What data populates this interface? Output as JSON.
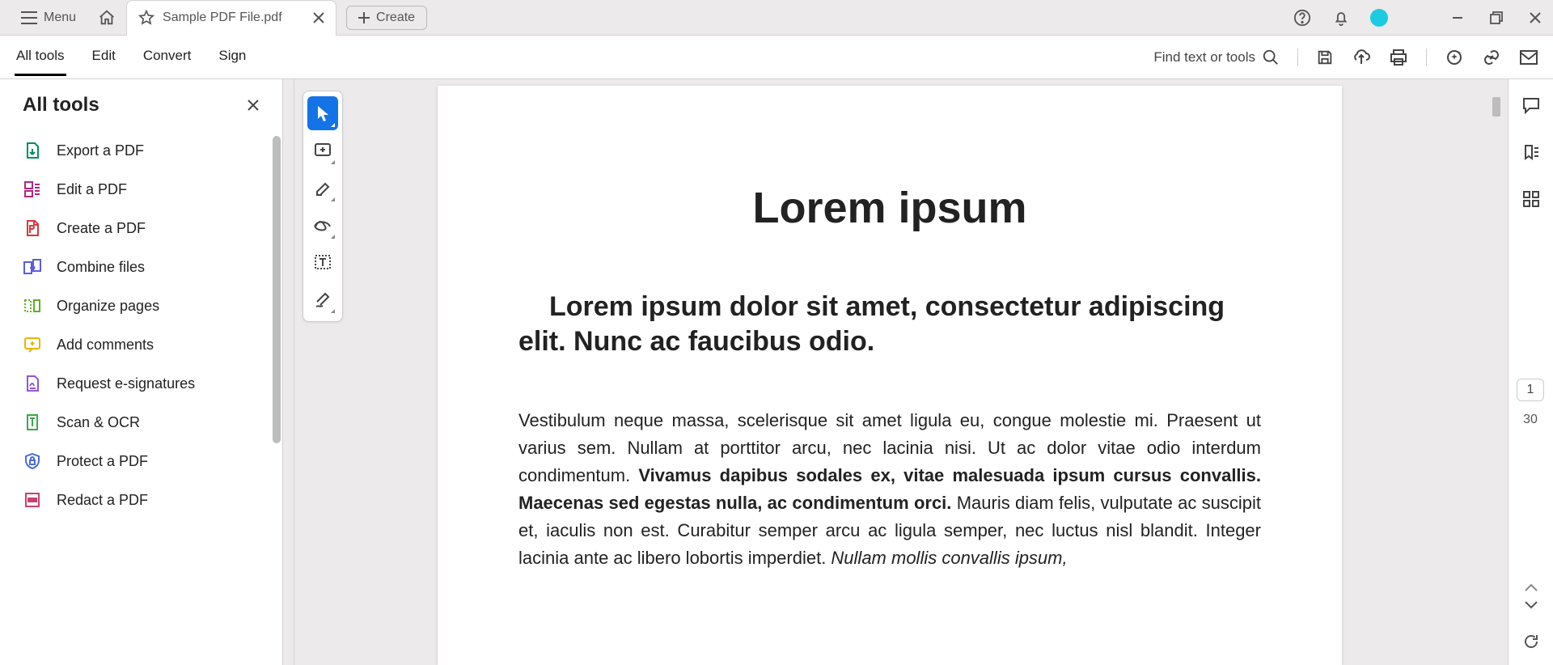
{
  "titlebar": {
    "menu_label": "Menu",
    "tab_title": "Sample PDF File.pdf",
    "create_label": "Create"
  },
  "toolrow": {
    "tabs": [
      "All tools",
      "Edit",
      "Convert",
      "Sign"
    ],
    "find_placeholder": "Find text or tools"
  },
  "sidebar": {
    "title": "All tools",
    "items": [
      {
        "label": "Export a PDF",
        "icon": "export",
        "color": "#008f5d"
      },
      {
        "label": "Edit a PDF",
        "icon": "edit",
        "color": "#b6257b"
      },
      {
        "label": "Create a PDF",
        "icon": "create",
        "color": "#d7373f"
      },
      {
        "label": "Combine files",
        "icon": "combine",
        "color": "#5c5ce0"
      },
      {
        "label": "Organize pages",
        "icon": "organize",
        "color": "#5faf2a"
      },
      {
        "label": "Add comments",
        "icon": "comment",
        "color": "#e9b500"
      },
      {
        "label": "Request e-signatures",
        "icon": "esign",
        "color": "#9256d9"
      },
      {
        "label": "Scan & OCR",
        "icon": "scan",
        "color": "#3da74e"
      },
      {
        "label": "Protect a PDF",
        "icon": "protect",
        "color": "#4b6bdc"
      },
      {
        "label": "Redact a PDF",
        "icon": "redact",
        "color": "#c9406e"
      }
    ]
  },
  "document": {
    "title": "Lorem ipsum",
    "subtitle_line1": "Lorem ipsum dolor sit amet, consectetur adipiscing",
    "subtitle_line2": "elit. Nunc ac faucibus odio.",
    "body_plain1": "Vestibulum neque massa, scelerisque sit amet ligula eu, congue molestie mi. Praesent ut varius sem. Nullam at porttitor arcu, nec lacinia nisi. Ut ac dolor vitae odio interdum condimentum. ",
    "body_bold1": "Vivamus dapibus sodales ex, vitae malesuada ipsum cursus convallis. Maecenas sed egestas nulla, ac condimentum orci.",
    "body_plain2": " Mauris diam felis, vulputate ac suscipit et, iaculis non est. Curabitur semper arcu ac ligula semper, nec luctus nisl blandit. Integer lacinia ante ac libero lobortis imperdiet. ",
    "body_italic1": "Nullam mollis convallis ipsum,"
  },
  "page_indicator": {
    "current": "1",
    "total": "30"
  }
}
